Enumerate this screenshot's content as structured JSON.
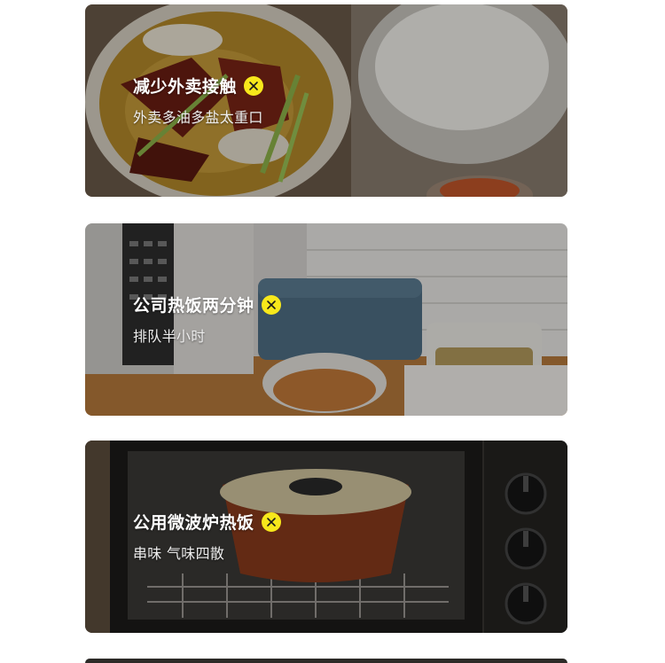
{
  "cards": [
    {
      "title": "减少外卖接触",
      "subtitle": "外卖多油多盐太重口",
      "badge_icon": "close-icon"
    },
    {
      "title": "公司热饭两分钟",
      "subtitle": "排队半小时",
      "badge_icon": "close-icon"
    },
    {
      "title": "公用微波炉热饭",
      "subtitle": "串味 气味四散",
      "badge_icon": "close-icon"
    }
  ],
  "colors": {
    "badge": "#f7e81b",
    "badge_mark": "#1a1a1a",
    "title_text": "#ffffff"
  }
}
